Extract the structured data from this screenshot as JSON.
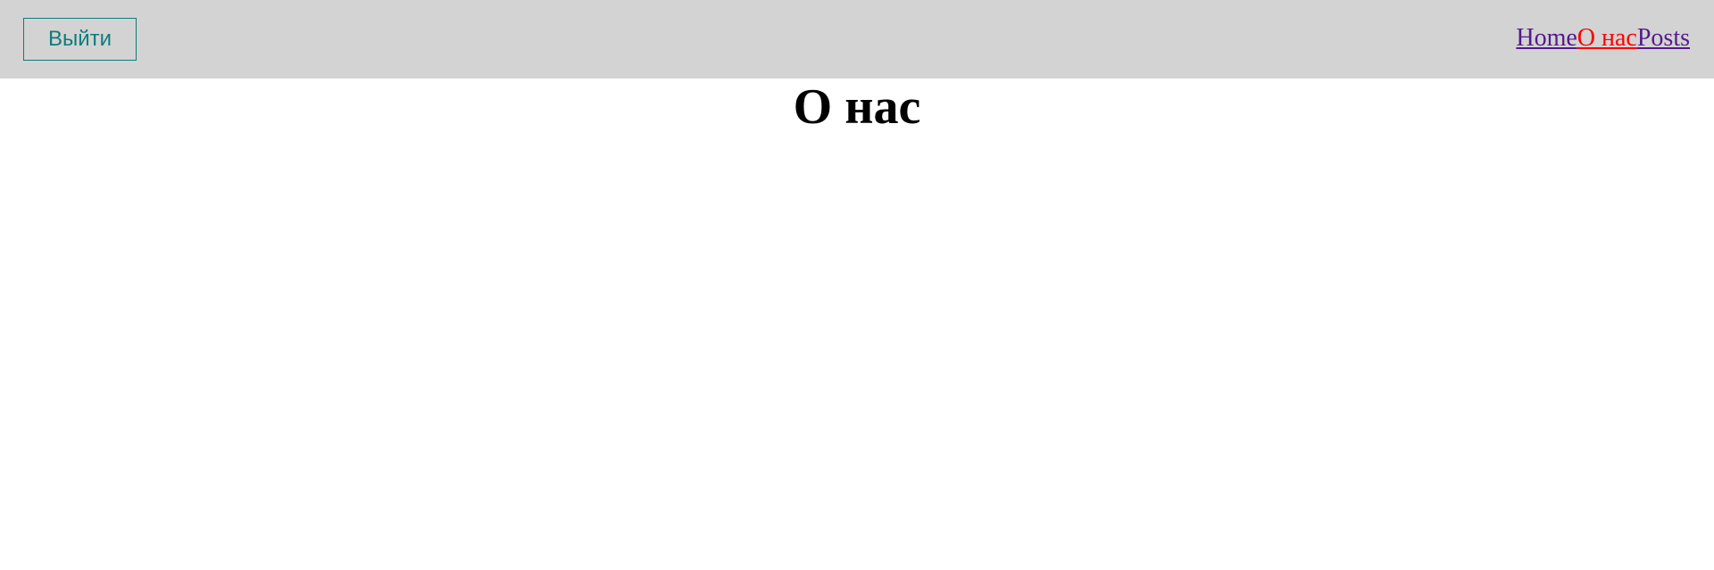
{
  "header": {
    "logout_label": "Выйти",
    "nav": {
      "home": "Home",
      "about": "О нас",
      "posts": "Posts",
      "active": "about"
    }
  },
  "main": {
    "title": "О нас"
  },
  "colors": {
    "navbar_bg": "#d3d3d3",
    "logout_accent": "#0e7c7b",
    "link": "#551a8b",
    "active_link": "#ff0000"
  }
}
